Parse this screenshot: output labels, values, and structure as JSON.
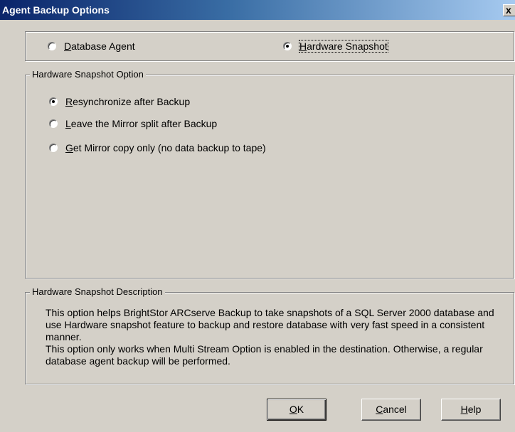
{
  "window": {
    "title": "Agent Backup Options",
    "close_glyph": "x"
  },
  "agent_type": {
    "options": [
      {
        "access_key": "D",
        "rest": "atabase Agent",
        "selected": false
      },
      {
        "access_key": "H",
        "rest": "ardware Snapshot",
        "selected": true
      }
    ]
  },
  "snapshot_option": {
    "legend": "Hardware Snapshot Option",
    "options": [
      {
        "access_key": "R",
        "rest": "esynchronize after Backup",
        "selected": true
      },
      {
        "access_key": "L",
        "rest": "eave the Mirror split after Backup",
        "selected": false
      },
      {
        "access_key": "G",
        "rest": "et Mirror copy only (no data backup to tape)",
        "selected": false
      }
    ]
  },
  "description": {
    "legend": "Hardware Snapshot Description",
    "paragraph_1": "This option helps BrightStor ARCserve Backup to take snapshots of a SQL Server 2000 database and use Hardware snapshot feature to backup and restore database with very fast speed in a consistent manner.",
    "paragraph_2": "This option only works when Multi Stream Option is enabled in the destination. Otherwise, a regular database agent backup will be performed."
  },
  "buttons": {
    "ok": {
      "access_key": "O",
      "rest": "K"
    },
    "cancel": {
      "access_key": "C",
      "rest": "ancel"
    },
    "help": {
      "access_key": "H",
      "rest": "elp"
    }
  }
}
